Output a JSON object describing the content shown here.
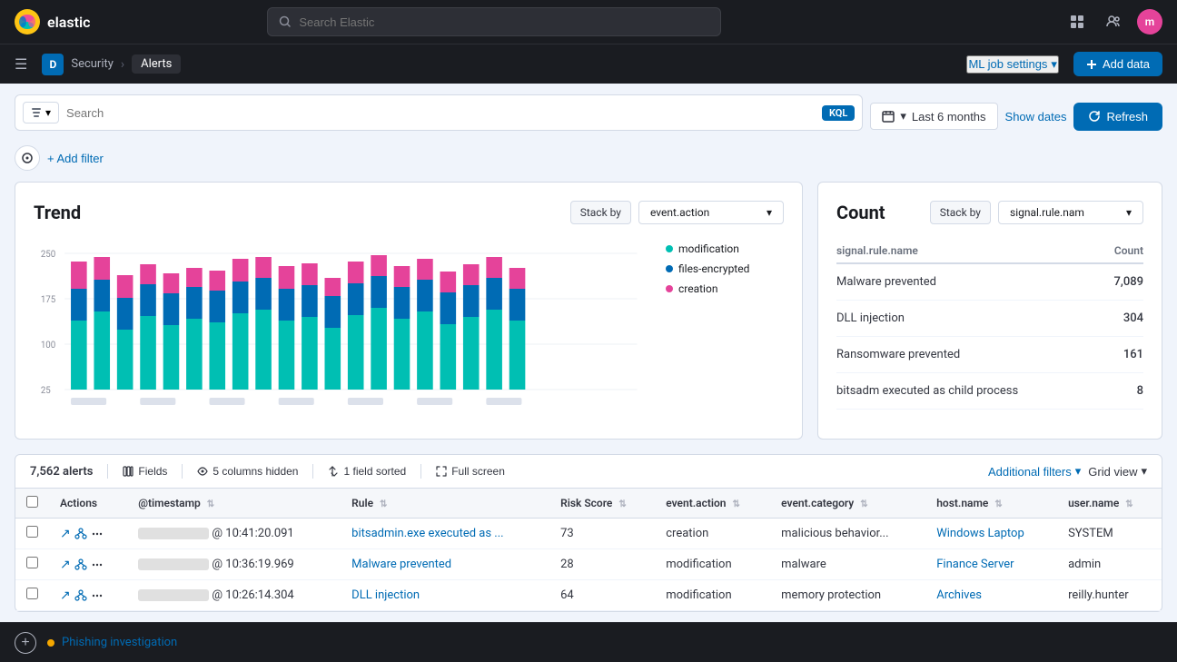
{
  "topnav": {
    "logo_text": "elastic",
    "search_placeholder": "Search Elastic",
    "avatar_initials": "m",
    "nav_icons": [
      "grid-icon",
      "people-icon"
    ]
  },
  "breadcrumb": {
    "workspace_letter": "D",
    "items": [
      "Security",
      "Alerts"
    ],
    "ml_job_settings": "ML job settings",
    "add_data": "Add data"
  },
  "filterbar": {
    "search_placeholder": "Search",
    "kql_label": "KQL",
    "date_range": "Last 6 months",
    "show_dates": "Show dates",
    "refresh": "Refresh",
    "add_filter": "+ Add filter"
  },
  "trend_panel": {
    "title": "Trend",
    "stack_by_label": "Stack by",
    "stack_by_value": "event.action",
    "legend": [
      {
        "label": "modification",
        "color": "#00bfb3"
      },
      {
        "label": "files-encrypted",
        "color": "#006bb4"
      },
      {
        "label": "creation",
        "color": "#e5439a"
      }
    ]
  },
  "count_panel": {
    "title": "Count",
    "stack_by_label": "Stack by",
    "stack_by_value": "signal.rule.nam",
    "col_name": "signal.rule.name",
    "col_count": "Count",
    "rows": [
      {
        "name": "Malware prevented",
        "count": "7,089"
      },
      {
        "name": "DLL injection",
        "count": "304"
      },
      {
        "name": "Ransomware prevented",
        "count": "161"
      },
      {
        "name": "bitsadm executed as child process",
        "count": "8"
      }
    ]
  },
  "alerts_table": {
    "total": "7,562 alerts",
    "fields_label": "Fields",
    "columns_hidden": "5 columns hidden",
    "field_sorted": "1 field sorted",
    "full_screen": "Full screen",
    "additional_filters": "Additional filters",
    "grid_view": "Grid view",
    "columns": [
      {
        "label": "Actions",
        "sortable": false
      },
      {
        "label": "@timestamp",
        "sortable": true
      },
      {
        "label": "Rule",
        "sortable": true
      },
      {
        "label": "Risk Score",
        "sortable": true
      },
      {
        "label": "event.action",
        "sortable": true
      },
      {
        "label": "event.category",
        "sortable": true
      },
      {
        "label": "host.name",
        "sortable": true
      },
      {
        "label": "user.name",
        "sortable": true
      }
    ],
    "rows": [
      {
        "timestamp_blur": "██████████",
        "timestamp_time": "@ 10:41:20.091",
        "rule": "bitsadmin.exe executed as ...",
        "risk_score": "73",
        "event_action": "creation",
        "event_category": "malicious behavior...",
        "host_name": "Windows Laptop",
        "user_name": "SYSTEM"
      },
      {
        "timestamp_blur": "██████████",
        "timestamp_time": "@ 10:36:19.969",
        "rule": "Malware prevented",
        "risk_score": "28",
        "event_action": "modification",
        "event_category": "malware",
        "host_name": "Finance Server",
        "user_name": "admin"
      },
      {
        "timestamp_blur": "██████████",
        "timestamp_time": "@ 10:26:14.304",
        "rule": "DLL injection",
        "risk_score": "64",
        "event_action": "modification",
        "event_category": "memory protection",
        "host_name": "Archives",
        "user_name": "reilly.hunter"
      }
    ]
  },
  "bottom_bar": {
    "case_label": "Phishing investigation",
    "add_tooltip": "Add case"
  },
  "colors": {
    "accent_blue": "#006bb4",
    "teal": "#00bfb3",
    "pink": "#e5439a",
    "warning": "#f5a700"
  }
}
